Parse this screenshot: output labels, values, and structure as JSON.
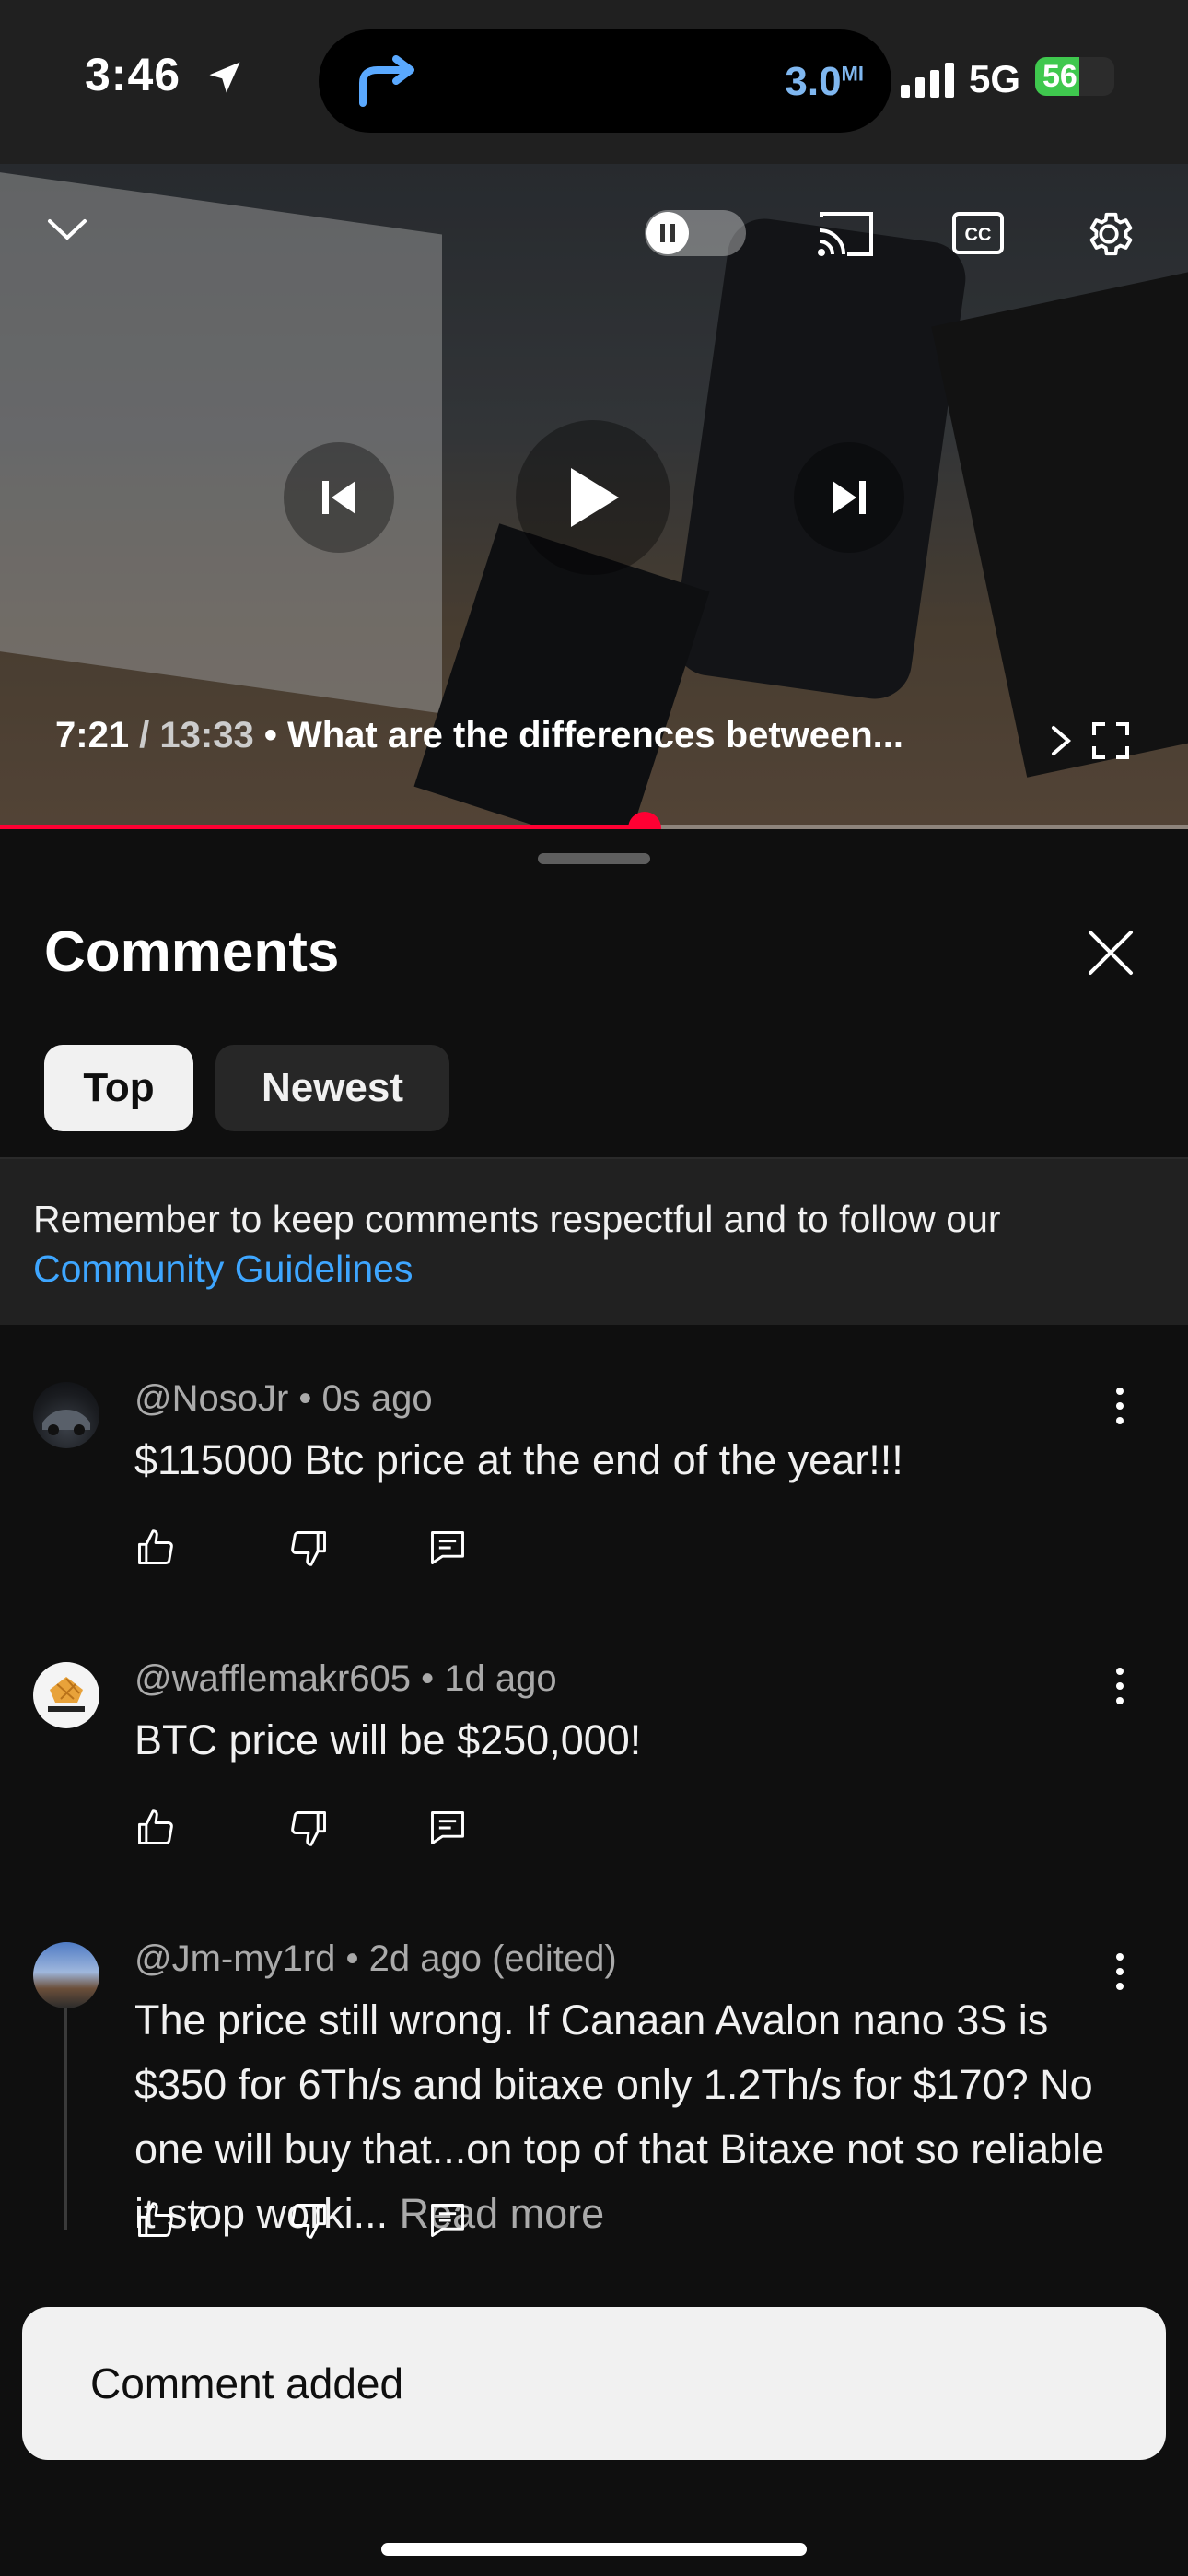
{
  "status_bar": {
    "time": "3:46",
    "distance": "3.0",
    "distance_unit": "MI",
    "network": "5G",
    "battery": "56",
    "battery_level": 0.56
  },
  "video": {
    "current_time": "7:21",
    "separator": " / ",
    "duration": "13:33",
    "dot": " • ",
    "chapter_title": "What are the differences between...",
    "progress": 0.543
  },
  "comments_sheet": {
    "title": "Comments",
    "tabs": [
      {
        "label": "Top",
        "selected": true
      },
      {
        "label": "Newest",
        "selected": false
      }
    ],
    "notice_text": "Remember to keep comments respectful and to follow our",
    "notice_link": "Community Guidelines",
    "comments": [
      {
        "author": "@NosoJr",
        "meta": " • 0s ago",
        "text": "$115000 Btc price at the end of the year!!!"
      },
      {
        "author": "@wafflemakr605",
        "meta": " • 1d ago",
        "text": "BTC  price will be $250,000!"
      },
      {
        "author": "@Jm-my1rd",
        "meta": " • 2d ago (edited)",
        "text": "The price still wrong. If Canaan Avalon nano 3S is $350 for 6Th/s and bitaxe only 1.2Th/s for $170? No one will buy that...on top of that Bitaxe not so reliable it stop worki...",
        "read_more": " Read more",
        "likes": "7"
      }
    ]
  },
  "toast": {
    "message": "Comment added"
  },
  "colors": {
    "accent_red": "#ff0033",
    "link_blue": "#3ea6ff",
    "battery_green": "#3fc84e"
  }
}
